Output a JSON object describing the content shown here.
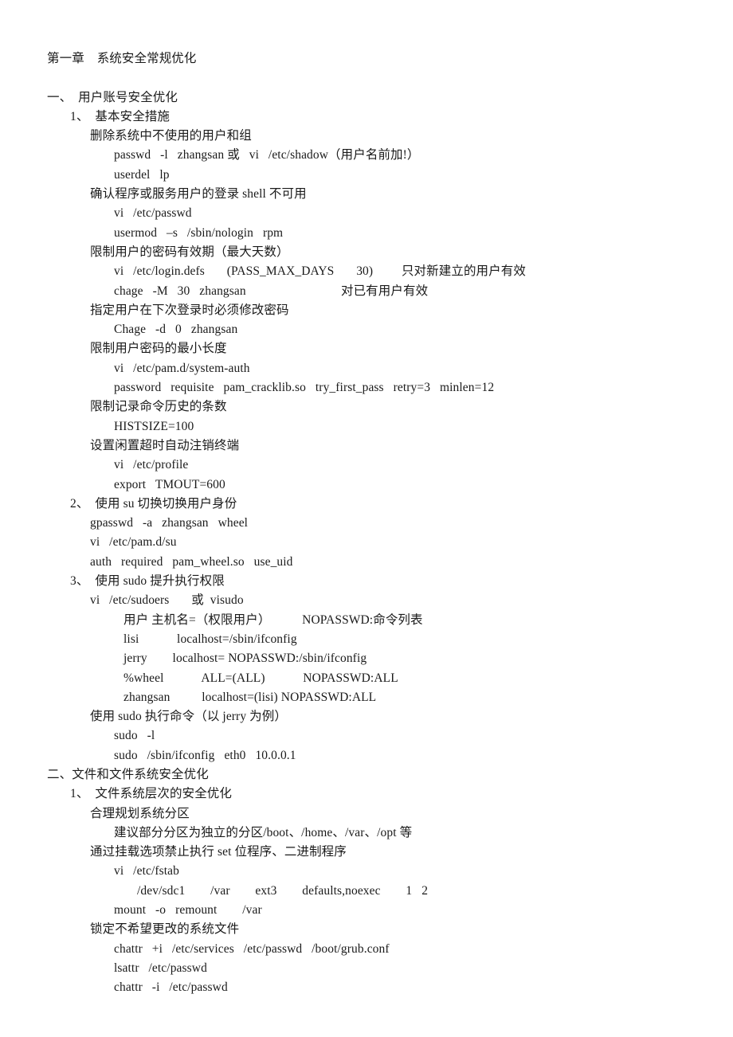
{
  "document": {
    "title_line": "第一章    系统安全常规优化",
    "lines": [
      {
        "id": "sec-1-heading",
        "indent": 1,
        "text": "一、  用户账号安全优化"
      },
      {
        "id": "sec-1-1-heading",
        "indent": 2,
        "text": "1、  基本安全措施"
      },
      {
        "id": "remove-unused-users",
        "indent": 3,
        "text": "删除系统中不使用的用户和组"
      },
      {
        "id": "cmd-passwd-lock",
        "indent": 4,
        "text": "passwd   -l   zhangsan 或   vi   /etc/shadow（用户名前加!）"
      },
      {
        "id": "cmd-userdel-lp",
        "indent": 4,
        "text": "userdel   lp"
      },
      {
        "id": "confirm-nologin",
        "indent": 3,
        "text": "确认程序或服务用户的登录 shell 不可用"
      },
      {
        "id": "cmd-vi-passwd",
        "indent": 4,
        "text": "vi   /etc/passwd"
      },
      {
        "id": "cmd-usermod-nologin",
        "indent": 4,
        "text": "usermod   –s   /sbin/nologin   rpm"
      },
      {
        "id": "limit-password-age",
        "indent": 3,
        "text": "限制用户的密码有效期（最大天数）"
      },
      {
        "id": "cmd-vi-login-defs",
        "indent": 4,
        "text": "vi   /etc/login.defs       (PASS_MAX_DAYS       30)         只对新建立的用户有效"
      },
      {
        "id": "cmd-chage-maxdays",
        "indent": 4,
        "text": "chage   -M   30   zhangsan                              对已有用户有效"
      },
      {
        "id": "force-change-next",
        "indent": 3,
        "text": "指定用户在下次登录时必须修改密码"
      },
      {
        "id": "cmd-chage-d0",
        "indent": 4,
        "text": "Chage   -d   0   zhangsan"
      },
      {
        "id": "limit-min-length",
        "indent": 3,
        "text": "限制用户密码的最小长度"
      },
      {
        "id": "cmd-vi-system-auth",
        "indent": 4,
        "text": "vi   /etc/pam.d/system-auth"
      },
      {
        "id": "cmd-pam-cracklib",
        "indent": 4,
        "text": "password   requisite   pam_cracklib.so   try_first_pass   retry=3   minlen=12"
      },
      {
        "id": "limit-history-size",
        "indent": 3,
        "text": "限制记录命令历史的条数"
      },
      {
        "id": "cmd-histsize",
        "indent": 4,
        "text": "HISTSIZE=100"
      },
      {
        "id": "idle-logout",
        "indent": 3,
        "text": "设置闲置超时自动注销终端"
      },
      {
        "id": "cmd-vi-profile",
        "indent": 4,
        "text": "vi   /etc/profile"
      },
      {
        "id": "cmd-export-tmout",
        "indent": 4,
        "text": "export   TMOUT=600"
      },
      {
        "id": "sec-1-2-heading",
        "indent": 2,
        "text": "2、  使用 su 切换切换用户身份"
      },
      {
        "id": "cmd-gpasswd-wheel",
        "indent": 3,
        "text": "gpasswd   -a   zhangsan   wheel"
      },
      {
        "id": "cmd-vi-pam-su",
        "indent": 3,
        "text": "vi   /etc/pam.d/su"
      },
      {
        "id": "cmd-pam-wheel",
        "indent": 3,
        "text": "auth   required   pam_wheel.so   use_uid"
      },
      {
        "id": "sec-1-3-heading",
        "indent": 2,
        "text": "3、  使用 sudo 提升执行权限"
      },
      {
        "id": "cmd-vi-sudoers",
        "indent": 3,
        "text": "vi   /etc/sudoers       或  visudo"
      },
      {
        "id": "sudoers-syntax",
        "indent": 5,
        "text": "用户 主机名=（权限用户）          NOPASSWD:命令列表"
      },
      {
        "id": "sudoers-lisi",
        "indent": 5,
        "text": "lisi            localhost=/sbin/ifconfig"
      },
      {
        "id": "sudoers-jerry",
        "indent": 5,
        "text": "jerry        localhost= NOPASSWD:/sbin/ifconfig"
      },
      {
        "id": "sudoers-wheel",
        "indent": 5,
        "text": "%wheel            ALL=(ALL)            NOPASSWD:ALL"
      },
      {
        "id": "sudoers-zhangsan",
        "indent": 5,
        "text": "zhangsan          localhost=(lisi) NOPASSWD:ALL"
      },
      {
        "id": "use-sudo-example",
        "indent": 3,
        "text": "使用 sudo 执行命令（以 jerry 为例）"
      },
      {
        "id": "cmd-sudo-list",
        "indent": 4,
        "text": "sudo   -l"
      },
      {
        "id": "cmd-sudo-ifconfig",
        "indent": 4,
        "text": "sudo   /sbin/ifconfig   eth0   10.0.0.1"
      },
      {
        "id": "sec-2-heading",
        "indent": 1,
        "text": "二、文件和文件系统安全优化"
      },
      {
        "id": "sec-2-1-heading",
        "indent": 2,
        "text": "1、  文件系统层次的安全优化"
      },
      {
        "id": "plan-partitions",
        "indent": 3,
        "text": "合理规划系统分区"
      },
      {
        "id": "partition-advice",
        "indent": 4,
        "text": "建议部分分区为独立的分区/boot、/home、/var、/opt 等"
      },
      {
        "id": "mount-noexec",
        "indent": 3,
        "text": "通过挂载选项禁止执行 set 位程序、二进制程序"
      },
      {
        "id": "cmd-vi-fstab",
        "indent": 4,
        "text": "vi   /etc/fstab"
      },
      {
        "id": "fstab-entry",
        "indent": 6,
        "text": "/dev/sdc1        /var        ext3        defaults,noexec        1   2"
      },
      {
        "id": "cmd-mount-remount",
        "indent": 4,
        "text": "mount   -o   remount        /var"
      },
      {
        "id": "lock-system-files",
        "indent": 3,
        "text": "锁定不希望更改的系统文件"
      },
      {
        "id": "cmd-chattr-add",
        "indent": 4,
        "text": "chattr   +i   /etc/services   /etc/passwd   /boot/grub.conf"
      },
      {
        "id": "cmd-lsattr",
        "indent": 4,
        "text": "lsattr   /etc/passwd"
      },
      {
        "id": "cmd-chattr-remove",
        "indent": 4,
        "text": "chattr   -i   /etc/passwd"
      }
    ]
  },
  "style": {
    "background_color": "#ffffff",
    "text_color": "#1a1a1a"
  }
}
